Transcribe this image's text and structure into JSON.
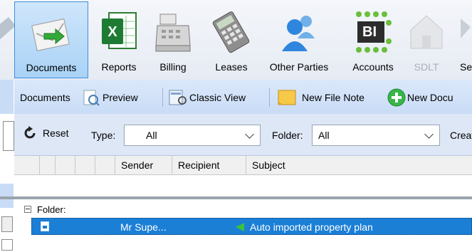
{
  "ribbon": {
    "items": [
      {
        "label": "Documents"
      },
      {
        "label": "Reports"
      },
      {
        "label": "Billing"
      },
      {
        "label": "Leases"
      },
      {
        "label": "Other Parties"
      },
      {
        "label": "Accounts"
      },
      {
        "label": "SDLT"
      },
      {
        "label": "Se"
      }
    ],
    "bi_text": "BI"
  },
  "toolbar": {
    "title": "Documents",
    "preview": "Preview",
    "classic_view": "Classic View",
    "new_file_note": "New File Note",
    "new_document": "New Docu"
  },
  "filter": {
    "reset": "Reset",
    "type_label": "Type:",
    "type_value": "All",
    "folder_label": "Folder:",
    "folder_value": "All",
    "created_label": "Create"
  },
  "grid": {
    "columns": [
      "",
      "",
      "",
      "",
      "Sender",
      "Recipient",
      "Subject"
    ],
    "group_label": "Folder:",
    "rows": [
      {
        "sender": "Mr Supe...",
        "subject": "Auto imported property plan"
      }
    ]
  },
  "colors": {
    "accent": "#1b7fd6",
    "toolbar": "#c9dcf6"
  }
}
